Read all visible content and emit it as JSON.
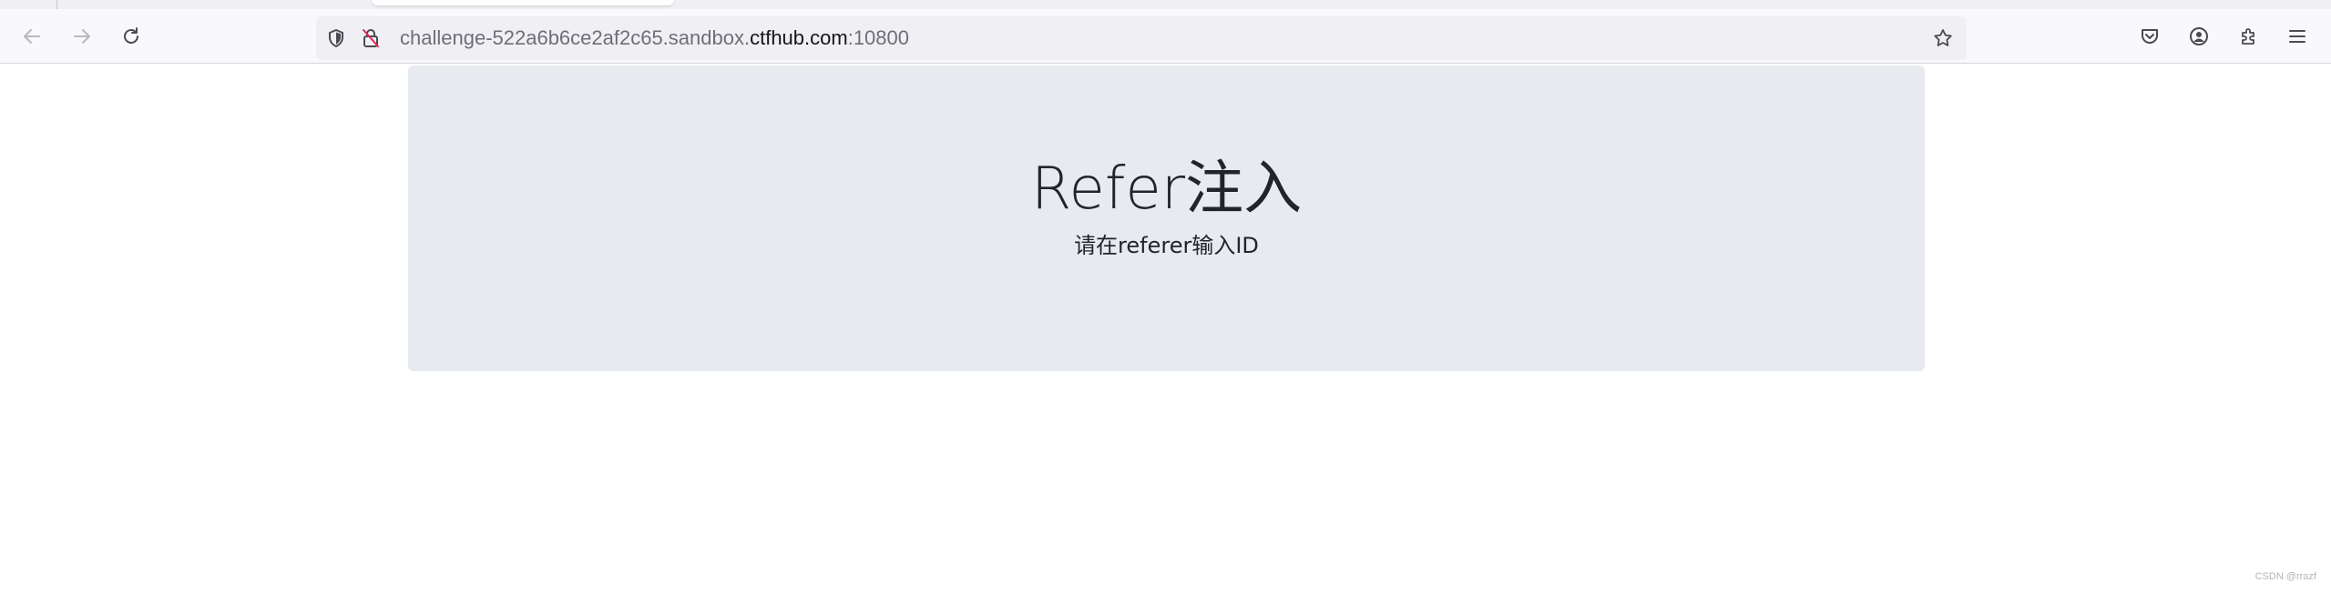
{
  "browser": {
    "url": {
      "prefix": "challenge-522a6b6ce2af2c65.sandbox.",
      "host": "ctfhub.com",
      "suffix": ":10800"
    },
    "icons": {
      "back": "back-arrow-icon",
      "forward": "forward-arrow-icon",
      "reload": "reload-icon",
      "shield": "tracking-protection-shield-icon",
      "insecure": "insecure-lock-icon",
      "bookmark": "bookmark-star-icon",
      "pocket": "pocket-icon",
      "account": "account-icon",
      "extensions": "extensions-icon",
      "menu": "hamburger-menu-icon"
    }
  },
  "page": {
    "title": "Refer注入",
    "subtitle": "请在referer输入ID"
  },
  "watermark": "CSDN @rrazf",
  "colors": {
    "jumbotron_bg": "#e7eaee",
    "text": "#212529",
    "toolbar_bg": "#f9f9fb",
    "urlbar_bg": "#f0f0f4"
  }
}
